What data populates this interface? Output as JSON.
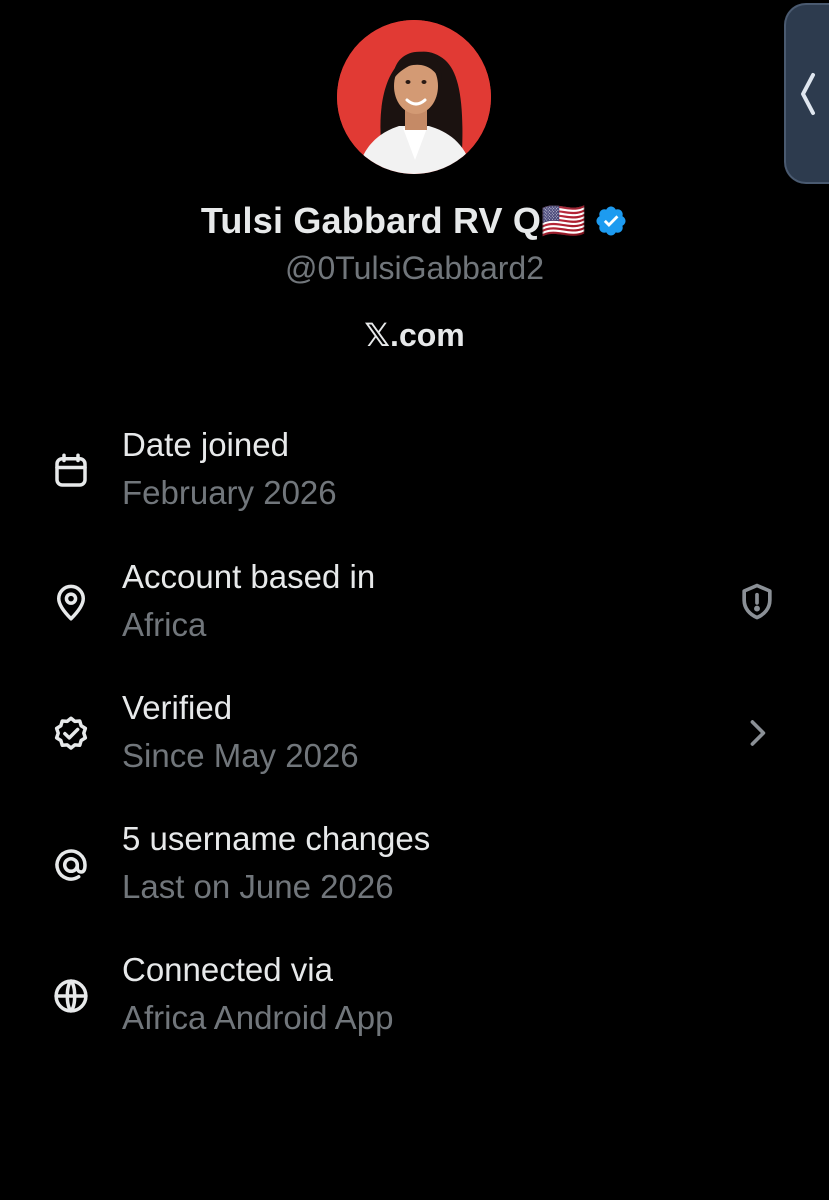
{
  "profile": {
    "display_name": "Tulsi Gabbard RV Q🇺🇸",
    "handle": "@0TulsiGabbard2",
    "site": "𝕏.com",
    "avatar_icon": "profile-photo",
    "verified_icon": "verified-badge-icon",
    "verified_color": "#1d9bf0"
  },
  "about": {
    "rows": [
      {
        "icon": "calendar-icon",
        "title": "Date joined",
        "value": "February 2026"
      },
      {
        "icon": "location-pin-icon",
        "title": "Account based in",
        "value": "Africa",
        "action_icon": "shield-alert-icon"
      },
      {
        "icon": "verified-outline-icon",
        "title": "Verified",
        "value": "Since May 2026",
        "action_icon": "chevron-right-icon"
      },
      {
        "icon": "at-sign-icon",
        "title": "5 username changes",
        "value": "Last on June 2026"
      },
      {
        "icon": "globe-icon",
        "title": "Connected via",
        "value": "Africa Android App"
      }
    ]
  },
  "colors": {
    "background": "#000000",
    "primary_text": "#e7e9ea",
    "secondary_text": "#71767b",
    "avatar_bg": "#e13a34",
    "edge_tab": "#2d3b4e"
  }
}
